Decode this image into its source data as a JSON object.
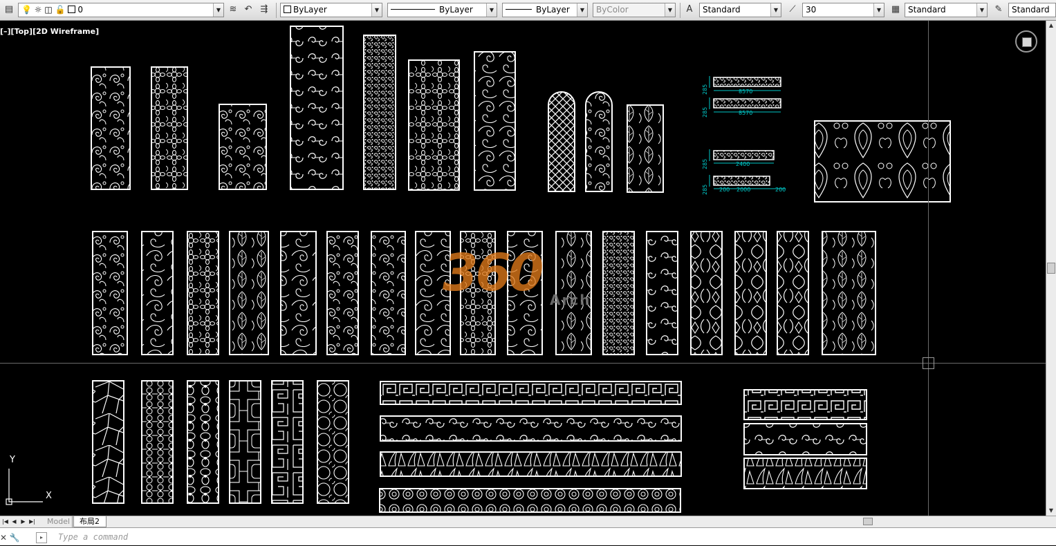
{
  "toolbar": {
    "layer": "0",
    "color_combo": "ByLayer",
    "linetype_combo": "ByLayer",
    "lineweight_combo": "ByLayer",
    "plotstyle_combo": "ByColor",
    "text_style": "Standard",
    "scale_value": "30",
    "dim_style": "Standard",
    "table_style": "Standard",
    "icons": [
      "layer-properties-icon",
      "lightbulb-icon",
      "sun-icon",
      "layer-freeze-icon",
      "padlock-icon",
      "layer-match-icon",
      "layer-previous-icon",
      "text-style-icon",
      "dim-style-icon",
      "table-style-icon",
      "multileader-style-icon"
    ]
  },
  "viewport": {
    "label": "[–][Top][2D Wireframe]"
  },
  "dimensions": {
    "d1": "285",
    "d2": "8570",
    "d3": "285",
    "d4": "8570",
    "d5": "285",
    "d6": "2400",
    "d7": "285",
    "d8": "200",
    "d9": "2000",
    "d10": "200"
  },
  "watermark": {
    "main": "360",
    "sub": "Arch"
  },
  "ucs": {
    "y_label": "Y",
    "x_label": "X"
  },
  "layout_tabs": [
    "Model",
    "布局2"
  ],
  "command": {
    "placeholder": "Type a command"
  },
  "colors": {
    "background": "#000000",
    "linework": "#ffffff",
    "dimension": "#00c8c8",
    "watermark": "#e07a1a",
    "crosshair": "#6a6a6a"
  }
}
